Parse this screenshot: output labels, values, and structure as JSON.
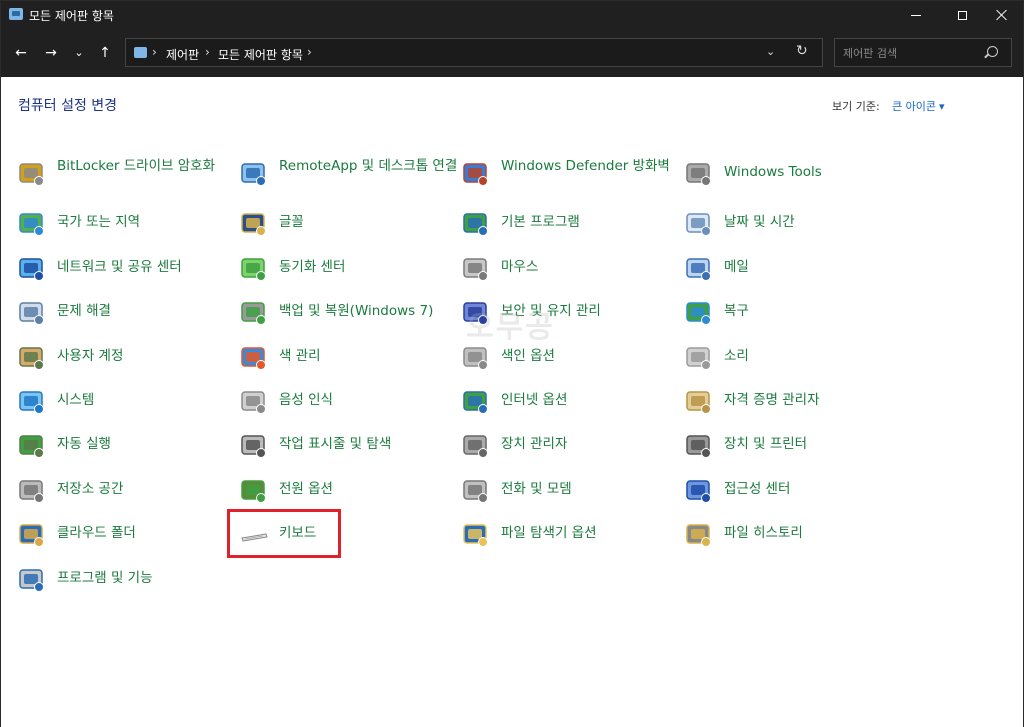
{
  "window": {
    "title": "모든 제어판 항목"
  },
  "breadcrumb": {
    "items": [
      "제어판",
      "모든 제어판 항목"
    ]
  },
  "search": {
    "placeholder": "제어판 검색"
  },
  "header": {
    "title": "컴퓨터 설정 변경",
    "view_by_label": "보기 기준:",
    "view_by_value": "큰 아이콘"
  },
  "watermark": "오무공",
  "items": [
    {
      "label": "BitLocker 드라이브 암호화",
      "icon": "bitlocker-icon"
    },
    {
      "label": "RemoteApp 및 데스크톱 연결",
      "icon": "remoteapp-icon"
    },
    {
      "label": "Windows Defender 방화벽",
      "icon": "firewall-icon"
    },
    {
      "label": "Windows Tools",
      "icon": "windows-tools-icon"
    },
    {
      "label": "국가 또는 지역",
      "icon": "globe-clock-icon"
    },
    {
      "label": "글꼴",
      "icon": "fonts-icon"
    },
    {
      "label": "기본 프로그램",
      "icon": "default-programs-icon"
    },
    {
      "label": "날짜 및 시간",
      "icon": "date-time-icon"
    },
    {
      "label": "네트워크 및 공유 센터",
      "icon": "network-icon"
    },
    {
      "label": "동기화 센터",
      "icon": "sync-icon"
    },
    {
      "label": "마우스",
      "icon": "mouse-icon"
    },
    {
      "label": "메일",
      "icon": "mail-icon"
    },
    {
      "label": "문제 해결",
      "icon": "troubleshoot-icon"
    },
    {
      "label": "백업 및 복원(Windows 7)",
      "icon": "backup-icon"
    },
    {
      "label": "보안 및 유지 관리",
      "icon": "security-flag-icon"
    },
    {
      "label": "복구",
      "icon": "recovery-icon"
    },
    {
      "label": "사용자 계정",
      "icon": "user-accounts-icon"
    },
    {
      "label": "색 관리",
      "icon": "color-management-icon"
    },
    {
      "label": "색인 옵션",
      "icon": "indexing-icon"
    },
    {
      "label": "소리",
      "icon": "sound-icon"
    },
    {
      "label": "시스템",
      "icon": "system-icon"
    },
    {
      "label": "음성 인식",
      "icon": "microphone-icon"
    },
    {
      "label": "인터넷 옵션",
      "icon": "internet-options-icon"
    },
    {
      "label": "자격 증명 관리자",
      "icon": "credential-icon"
    },
    {
      "label": "자동 실행",
      "icon": "autoplay-icon"
    },
    {
      "label": "작업 표시줄 및 탐색",
      "icon": "taskbar-icon"
    },
    {
      "label": "장치 관리자",
      "icon": "device-manager-icon"
    },
    {
      "label": "장치 및 프린터",
      "icon": "printer-icon"
    },
    {
      "label": "저장소 공간",
      "icon": "storage-icon"
    },
    {
      "label": "전원 옵션",
      "icon": "power-icon"
    },
    {
      "label": "전화 및 모뎀",
      "icon": "phone-modem-icon"
    },
    {
      "label": "접근성 센터",
      "icon": "accessibility-icon"
    },
    {
      "label": "클라우드 폴더",
      "icon": "work-folders-icon"
    },
    {
      "label": "키보드",
      "icon": "keyboard-icon"
    },
    {
      "label": "파일 탐색기 옵션",
      "icon": "folder-options-icon"
    },
    {
      "label": "파일 히스토리",
      "icon": "file-history-icon"
    },
    {
      "label": "프로그램 및 기능",
      "icon": "programs-features-icon"
    }
  ]
}
